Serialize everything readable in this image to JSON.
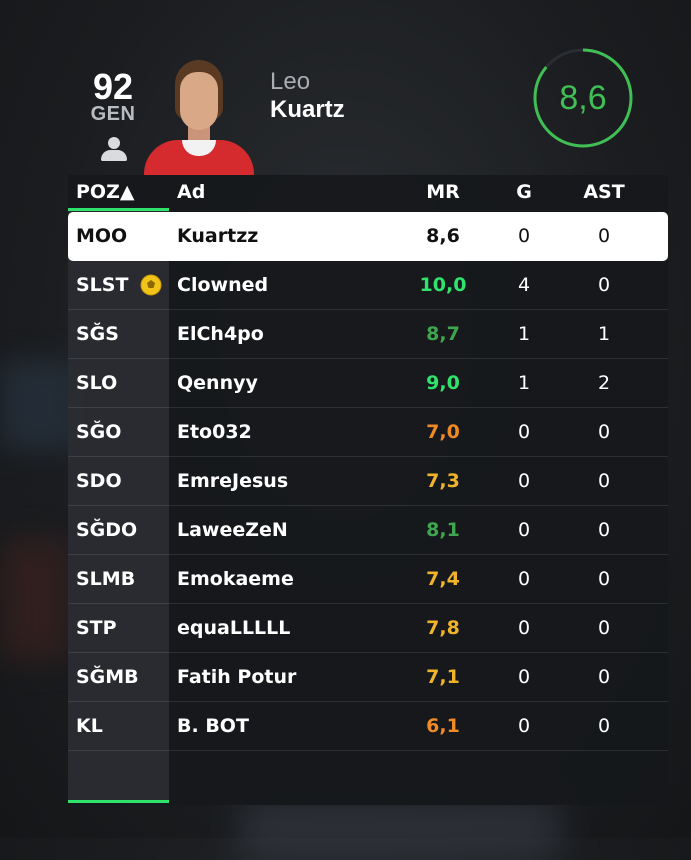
{
  "player": {
    "overall": "92",
    "overall_label": "GEN",
    "first_name": "Leo",
    "last_name": "Kuartz",
    "match_rating": "8,6",
    "rating_fraction": 0.86
  },
  "table": {
    "headers": {
      "poz": "POZ▲",
      "name": "Ad",
      "mr": "MR",
      "g": "G",
      "ast": "AST"
    },
    "rows": [
      {
        "poz": "MOO",
        "name": "Kuartzz",
        "mr": "8,6",
        "mr_color": "#111111",
        "g": "0",
        "ast": "0",
        "selected": true
      },
      {
        "poz": "SLST",
        "name": "Clowned",
        "mr": "10,0",
        "mr_color": "#2fe36d",
        "g": "4",
        "ast": "0",
        "motm": true
      },
      {
        "poz": "SĞS",
        "name": "ElCh4po",
        "mr": "8,7",
        "mr_color": "#3fa64f",
        "g": "1",
        "ast": "1"
      },
      {
        "poz": "SLO",
        "name": "Qennyy",
        "mr": "9,0",
        "mr_color": "#2fe36d",
        "g": "1",
        "ast": "2"
      },
      {
        "poz": "SĞO",
        "name": "Eto032",
        "mr": "7,0",
        "mr_color": "#f08a25",
        "g": "0",
        "ast": "0"
      },
      {
        "poz": "SDO",
        "name": "EmreJesus",
        "mr": "7,3",
        "mr_color": "#f0b42a",
        "g": "0",
        "ast": "0"
      },
      {
        "poz": "SĞDO",
        "name": "LaweeZeN",
        "mr": "8,1",
        "mr_color": "#3fa64f",
        "g": "0",
        "ast": "0"
      },
      {
        "poz": "SLMB",
        "name": "Emokaeme",
        "mr": "7,4",
        "mr_color": "#f0b42a",
        "g": "0",
        "ast": "0"
      },
      {
        "poz": "STP",
        "name": "equaLLLLL",
        "mr": "7,8",
        "mr_color": "#f0b42a",
        "g": "0",
        "ast": "0"
      },
      {
        "poz": "SĞMB",
        "name": "Fatih Potur",
        "mr": "7,1",
        "mr_color": "#f0b42a",
        "g": "0",
        "ast": "0"
      },
      {
        "poz": "KL",
        "name": "B. BOT",
        "mr": "6,1",
        "mr_color": "#f08a25",
        "g": "0",
        "ast": "0"
      }
    ]
  },
  "colors": {
    "accent_green": "#2ee26b",
    "rating_ring": "#3fbf55"
  }
}
